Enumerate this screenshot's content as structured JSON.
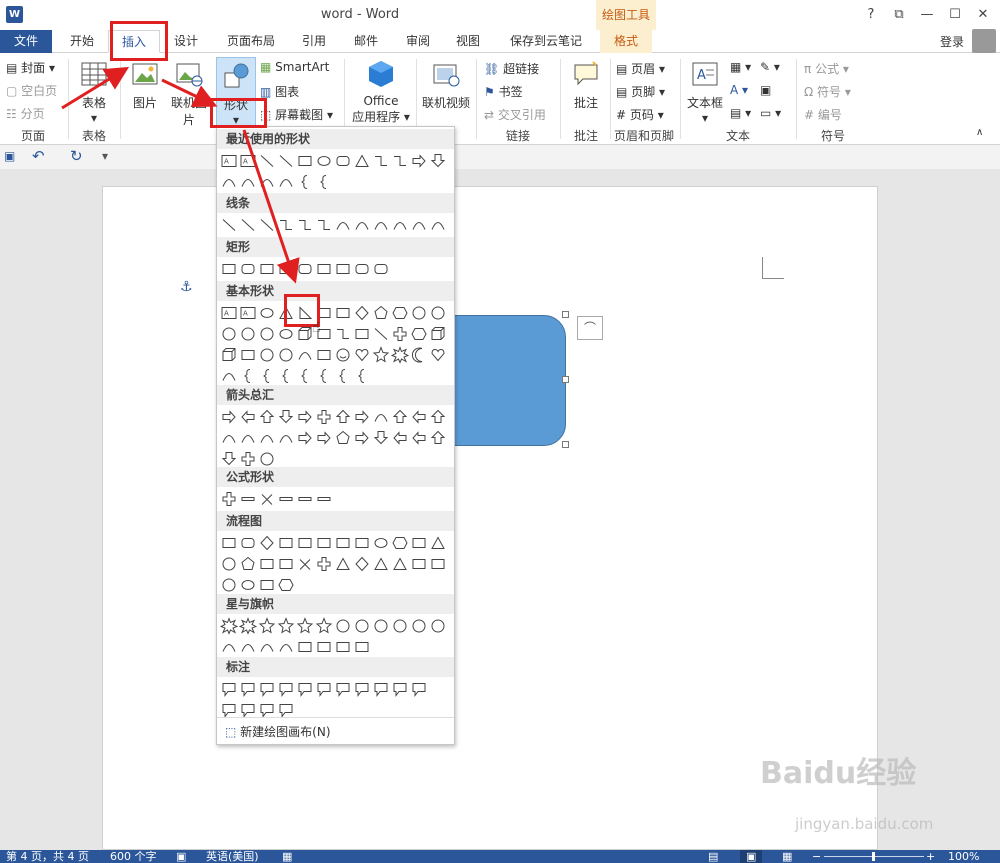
{
  "window": {
    "title": "word - Word",
    "app_badge": "W",
    "context_tool": "绘图工具",
    "help": "?",
    "restore": "⧉",
    "min": "—",
    "max": "☐",
    "close": "✕"
  },
  "tabs": [
    "文件",
    "开始",
    "插入",
    "设计",
    "页面布局",
    "引用",
    "邮件",
    "审阅",
    "视图",
    "保存到云笔记",
    "格式"
  ],
  "login": "登录",
  "ribbon": {
    "page_group": {
      "items": [
        "封面",
        "空白页",
        "分页"
      ],
      "label": "页面"
    },
    "table_group": {
      "button": "表格",
      "label": "表格"
    },
    "illustrations": {
      "picture": "图片",
      "online_picture": "联机图片",
      "shapes": "形状",
      "smartart": "SmartArt",
      "chart": "图表",
      "screenshot": "屏幕截图"
    },
    "apps": {
      "office": "Office",
      "apps": "应用程序"
    },
    "media": {
      "online_video": "联机视频"
    },
    "links": {
      "hyperlink": "超链接",
      "bookmark": "书签",
      "cross_ref": "交叉引用",
      "label": "链接"
    },
    "comments": {
      "comment": "批注",
      "label": "批注"
    },
    "header_footer": {
      "header": "页眉",
      "footer": "页脚",
      "page_number": "页码",
      "label": "页眉和页脚"
    },
    "text": {
      "textbox": "文本框",
      "label": "文本",
      "dropcap": "A"
    },
    "symbols": {
      "equation": "公式",
      "symbol": "符号",
      "numbering": "编号",
      "label": "符号",
      "pi": "π",
      "omega": "Ω"
    }
  },
  "qat": {
    "save": "💾",
    "undo": "↶",
    "redo": "↻",
    "customize": "▾"
  },
  "dropdown": {
    "sections": [
      "最近使用的形状",
      "线条",
      "矩形",
      "基本形状",
      "箭头总汇",
      "公式形状",
      "流程图",
      "星与旗帜",
      "标注"
    ],
    "new_canvas": "新建绘图画布(N)"
  },
  "status": {
    "page": "第 4 页，共 4 页",
    "words": "600 个字",
    "lang": "英语(美国)",
    "zoom": "100%",
    "minus": "−",
    "plus": "+"
  },
  "watermark": {
    "logo": "Baidu经验",
    "url": "jingyan.baidu.com"
  }
}
